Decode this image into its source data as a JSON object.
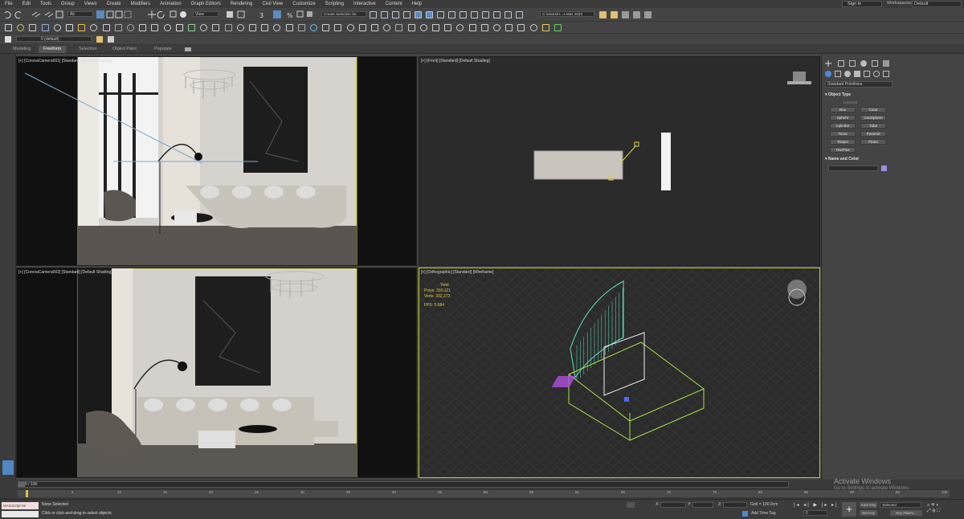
{
  "menu": [
    "File",
    "Edit",
    "Tools",
    "Group",
    "Views",
    "Create",
    "Modifiers",
    "Animation",
    "Graph Editors",
    "Rendering",
    "Civil View",
    "Customize",
    "Scripting",
    "Interactive",
    "Content",
    "Help"
  ],
  "account": {
    "sign_in": "Sign In",
    "workspaces_label": "Workspaces:",
    "workspace": "Default"
  },
  "toolbar": {
    "selection_filter": "All",
    "reference_coord": "View",
    "selection_set": "Create Selection Se",
    "path": "C:\\Users\\H...s Max 2020",
    "layer": "0 (default)"
  },
  "ribbon": {
    "tabs": [
      "Modeling",
      "Freeform",
      "Selection",
      "Object Paint",
      "Populate"
    ],
    "active": "Freeform"
  },
  "viewports": {
    "top_left": {
      "label": "[+] [CoronaCamera001] [Standard] [Default Shading]"
    },
    "top_right": {
      "label": "[+] [Front] [Standard] [Default Shading]"
    },
    "bottom_left": {
      "label": "[+] [CoronaCamera002] [Standard] [Default Shading]"
    },
    "bottom_right": {
      "label": "[+] [Orthographic] [Standard] [Wireframe]"
    }
  },
  "stats": {
    "total_label": "Total",
    "polys_label": "Polys:",
    "polys": "330,121",
    "verts_label": "Verts:",
    "verts": "332,373",
    "fps_label": "FPS:",
    "fps": "5.684"
  },
  "command_panel": {
    "category": "Standard Primitives",
    "object_type_title": "Object Type",
    "autogrid": "AutoGrid",
    "primitives": [
      "Box",
      "Cone",
      "Sphere",
      "GeoSphere",
      "Cylinder",
      "Tube",
      "Torus",
      "Pyramid",
      "Teapot",
      "Plane",
      "TextPlus"
    ],
    "name_color_title": "Name and Color",
    "object_color": "#9b8de8"
  },
  "timeline": {
    "frame_display": "0 / 100",
    "ticks": [
      "0",
      "5",
      "10",
      "15",
      "20",
      "25",
      "30",
      "35",
      "40",
      "45",
      "50",
      "55",
      "60",
      "65",
      "70",
      "75",
      "80",
      "85",
      "90",
      "95",
      "100"
    ]
  },
  "status_bar": {
    "script_listener": "MAXScript Mi",
    "selection": "None Selected",
    "prompt": "Click or click-and-drag to select objects",
    "x_label": "X:",
    "y_label": "Y:",
    "z_label": "Z:",
    "grid": "Grid = 100.0cm",
    "add_time_tag": "Add Time Tag",
    "auto_key": "Auto Key",
    "set_key": "Set Key",
    "key_mode": "Selected",
    "key_filters": "Key Filters...",
    "frame": "0"
  },
  "activation": {
    "title": "Activate Windows",
    "subtitle": "Go to Settings to activate Windows."
  }
}
